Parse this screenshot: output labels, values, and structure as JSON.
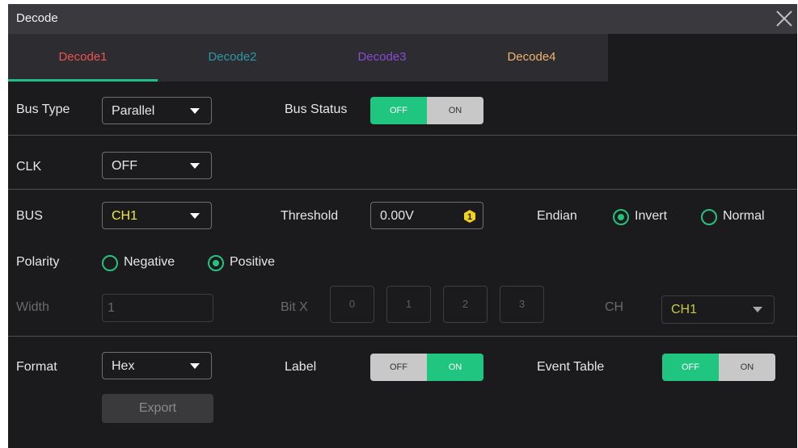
{
  "window": {
    "title": "Decode",
    "close_icon": "close-icon"
  },
  "tabs": [
    {
      "label": "Decode1",
      "color": "#f0524f",
      "selected": true
    },
    {
      "label": "Decode2",
      "color": "#2b9aa6"
    },
    {
      "label": "Decode3",
      "color": "#8a4ad6"
    },
    {
      "label": "Decode4",
      "color": "#f2b46c"
    }
  ],
  "bus_type": {
    "label": "Bus Type",
    "value": "Parallel"
  },
  "bus_status": {
    "label": "Bus Status",
    "off": "OFF",
    "on": "ON",
    "active": "OFF"
  },
  "clk": {
    "label": "CLK",
    "value": "OFF"
  },
  "bus": {
    "label": "BUS",
    "value": "CH1",
    "value_color": "#f2e93a"
  },
  "threshold": {
    "label": "Threshold",
    "value": "0.00V",
    "icon": "knob-1-icon",
    "badge": "1"
  },
  "endian": {
    "label": "Endian",
    "options": [
      "Invert",
      "Normal"
    ],
    "selected": "Invert"
  },
  "polarity": {
    "label": "Polarity",
    "options": [
      "Negative",
      "Positive"
    ],
    "selected": "Positive"
  },
  "width": {
    "label": "Width",
    "value": "1"
  },
  "bitx": {
    "label": "Bit X",
    "bits": [
      "0",
      "1",
      "2",
      "3"
    ]
  },
  "ch": {
    "label": "CH",
    "value": "CH1",
    "value_color": "#c8c83a"
  },
  "format": {
    "label": "Format",
    "value": "Hex"
  },
  "label_toggle": {
    "label": "Label",
    "off": "OFF",
    "on": "ON",
    "active": "ON"
  },
  "event_table": {
    "label": "Event Table",
    "off": "OFF",
    "on": "ON",
    "active": "OFF"
  },
  "export": {
    "label": "Export"
  }
}
